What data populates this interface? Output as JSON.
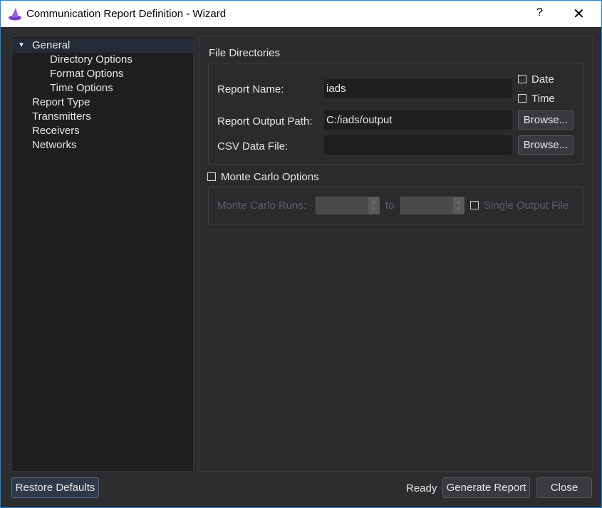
{
  "window": {
    "title": "Communication Report Definition - Wizard",
    "help": "?",
    "close": "✕",
    "icon": "wizard-hat-icon"
  },
  "tree": {
    "items": [
      {
        "label": "General",
        "level": 0,
        "expanded": true,
        "selected": true
      },
      {
        "label": "Directory Options",
        "level": 1
      },
      {
        "label": "Format Options",
        "level": 1
      },
      {
        "label": "Time Options",
        "level": 1
      },
      {
        "label": "Report Type",
        "level": 0
      },
      {
        "label": "Transmitters",
        "level": 0
      },
      {
        "label": "Receivers",
        "level": 0
      },
      {
        "label": "Networks",
        "level": 0
      }
    ]
  },
  "file_directories": {
    "title": "File Directories",
    "report_name_label": "Report Name:",
    "report_name_value": "iads",
    "date_label": "Date",
    "date_checked": false,
    "time_label": "Time",
    "time_checked": false,
    "output_path_label": "Report Output Path:",
    "output_path_value": "C:/iads/output",
    "csv_label": "CSV Data File:",
    "csv_value": "",
    "browse_label": "Browse..."
  },
  "monte_carlo": {
    "title": "Monte Carlo Options",
    "checked": false,
    "runs_label": "Monte Carlo Runs:",
    "to_label": "to",
    "single_output_label": "Single Output File",
    "single_output_checked": false,
    "enabled": false
  },
  "footer": {
    "restore": "Restore Defaults",
    "status": "Ready",
    "generate": "Generate Report",
    "close": "Close"
  },
  "colors": {
    "accent": "#1883d7",
    "background": "#2d2d30"
  }
}
